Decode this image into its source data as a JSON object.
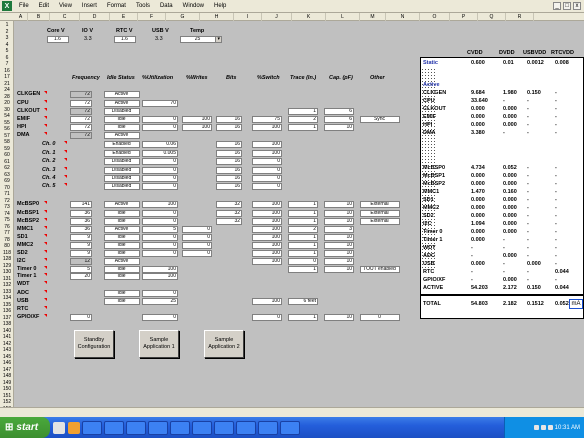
{
  "menubar": {
    "app_icon": "excel-icon",
    "items": [
      "File",
      "Edit",
      "View",
      "Insert",
      "Format",
      "Tools",
      "Data",
      "Window",
      "Help"
    ],
    "window_buttons": [
      "_",
      "□",
      "x"
    ]
  },
  "columns": [
    "A",
    "B",
    "C",
    "D",
    "E",
    "F",
    "G",
    "H",
    "I",
    "J",
    "K",
    "L",
    "M",
    "N",
    "O",
    "P",
    "Q",
    "R"
  ],
  "rows": [
    "1",
    "2",
    "3",
    "4",
    "5",
    "6",
    "7",
    "16",
    "17",
    "21",
    "24",
    "28",
    "20",
    "30",
    "54",
    "55",
    "56",
    "57",
    "58",
    "59",
    "60",
    "61",
    "62",
    "63",
    "69",
    "70",
    "71",
    "72",
    "73",
    "74",
    "75",
    "76",
    "77",
    "78",
    "80",
    "118",
    "128",
    "129",
    "130",
    "131",
    "132",
    "133",
    "134",
    "135",
    "136",
    "137",
    "138",
    "140",
    "141",
    "142",
    "143",
    "145",
    "146",
    "147",
    "148",
    "149",
    "150",
    "151",
    "152",
    "153",
    "154"
  ],
  "settings": {
    "core_v_label": "Core V",
    "core_v_val": "1.6",
    "io_v_label": "IO V",
    "io_v_val": "3.3",
    "rtc_v_label": "RTC V",
    "rtc_v_val": "1.6",
    "usb_v_label": "USB V",
    "usb_v_val": "3.3",
    "temp_label": "Temp",
    "temp_val": "25"
  },
  "table_headers": [
    "Frequency",
    "Idle Status",
    "%Utilization",
    "%Writes",
    "Bits",
    "%Switch",
    "Trace (In.)",
    "Cap. (pF)",
    "Other"
  ],
  "modules": [
    {
      "name": "CLKGEN",
      "freq": "72",
      "status": "Active",
      "util": "",
      "writes": "",
      "bits": "",
      "switch": "",
      "trace": "",
      "cap": "",
      "other": ""
    },
    {
      "name": "CPU",
      "freq": "72",
      "status": "Active",
      "util": "70",
      "writes": "",
      "bits": "",
      "switch": "",
      "trace": "",
      "cap": "",
      "other": ""
    },
    {
      "name": "CLKOUT",
      "freq": "72",
      "status": "Disabled",
      "util": "",
      "writes": "",
      "bits": "",
      "switch": "",
      "trace": "1",
      "cap": "6",
      "other": ""
    },
    {
      "name": "EMIF",
      "freq": "72",
      "status": "Idle",
      "util": "0",
      "writes": "100",
      "bits": "16",
      "switch": "75",
      "trace": "2",
      "cap": "6",
      "other": "Sync"
    },
    {
      "name": "HPI",
      "freq": "72",
      "status": "Idle",
      "util": "0",
      "writes": "100",
      "bits": "16",
      "switch": "100",
      "trace": "1",
      "cap": "10",
      "other": ""
    },
    {
      "name": "DMA",
      "freq": "72",
      "status": "Active",
      "util": "",
      "writes": "",
      "bits": "",
      "switch": "",
      "trace": "",
      "cap": "",
      "other": ""
    },
    {
      "name": "Ch. 0",
      "freq": "",
      "status": "Enabled",
      "util": "0.06",
      "writes": "",
      "bits": "16",
      "switch": "100",
      "trace": "",
      "cap": "",
      "other": ""
    },
    {
      "name": "Ch. 1",
      "freq": "",
      "status": "Enabled",
      "util": "0.005",
      "writes": "",
      "bits": "16",
      "switch": "100",
      "trace": "",
      "cap": "",
      "other": ""
    },
    {
      "name": "Ch. 2",
      "freq": "",
      "status": "Disabled",
      "util": "0",
      "writes": "",
      "bits": "16",
      "switch": "0",
      "trace": "",
      "cap": "",
      "other": ""
    },
    {
      "name": "Ch. 3",
      "freq": "",
      "status": "Disabled",
      "util": "0",
      "writes": "",
      "bits": "16",
      "switch": "0",
      "trace": "",
      "cap": "",
      "other": ""
    },
    {
      "name": "Ch. 4",
      "freq": "",
      "status": "Disabled",
      "util": "0",
      "writes": "",
      "bits": "16",
      "switch": "0",
      "trace": "",
      "cap": "",
      "other": ""
    },
    {
      "name": "Ch. 5",
      "freq": "",
      "status": "Disabled",
      "util": "0",
      "writes": "",
      "bits": "16",
      "switch": "0",
      "trace": "",
      "cap": "",
      "other": ""
    },
    {
      "name": "McBSP0",
      "freq": "141",
      "status": "Active",
      "util": "100",
      "writes": "",
      "bits": "32",
      "switch": "100",
      "trace": "1",
      "cap": "10",
      "other": "External"
    },
    {
      "name": "McBSP1",
      "freq": "36",
      "status": "Idle",
      "util": "0",
      "writes": "",
      "bits": "32",
      "switch": "100",
      "trace": "1",
      "cap": "10",
      "other": "External"
    },
    {
      "name": "McBSP2",
      "freq": "36",
      "status": "Idle",
      "util": "0",
      "writes": "",
      "bits": "32",
      "switch": "100",
      "trace": "1",
      "cap": "10",
      "other": "External"
    },
    {
      "name": "MMC1",
      "freq": "36",
      "status": "Active",
      "util": "5",
      "writes": "0",
      "bits": "",
      "switch": "100",
      "trace": "2",
      "cap": "3",
      "other": ""
    },
    {
      "name": "SD1",
      "freq": "9",
      "status": "Idle",
      "util": "0",
      "writes": "0",
      "bits": "",
      "switch": "100",
      "trace": "1",
      "cap": "10",
      "other": ""
    },
    {
      "name": "MMC2",
      "freq": "9",
      "status": "Idle",
      "util": "0",
      "writes": "0",
      "bits": "",
      "switch": "100",
      "trace": "1",
      "cap": "10",
      "other": ""
    },
    {
      "name": "SD2",
      "freq": "9",
      "status": "Idle",
      "util": "0",
      "writes": "0",
      "bits": "",
      "switch": "100",
      "trace": "1",
      "cap": "10",
      "other": ""
    },
    {
      "name": "I2C",
      "freq": "12",
      "status": "Active",
      "util": "",
      "writes": "",
      "bits": "",
      "switch": "100",
      "trace": "0",
      "cap": "10",
      "other": ""
    },
    {
      "name": "Timer 0",
      "freq": "5",
      "status": "Idle",
      "util": "100",
      "writes": "",
      "bits": "",
      "switch": "",
      "trace": "1",
      "cap": "10",
      "other": "TOUT enabled"
    },
    {
      "name": "Timer 1",
      "freq": "20",
      "status": "Idle",
      "util": "100",
      "writes": "",
      "bits": "",
      "switch": "",
      "trace": "",
      "cap": "",
      "other": ""
    },
    {
      "name": "WDT",
      "freq": "",
      "status": "",
      "util": "",
      "writes": "",
      "bits": "",
      "switch": "",
      "trace": "",
      "cap": "",
      "other": ""
    },
    {
      "name": "ADC",
      "freq": "",
      "status": "Idle",
      "util": "0",
      "writes": "",
      "bits": "",
      "switch": "",
      "trace": "",
      "cap": "",
      "other": ""
    },
    {
      "name": "USB",
      "freq": "",
      "status": "Idle",
      "util": "25",
      "writes": "",
      "bits": "",
      "switch": "100",
      "trace": "6 feet",
      "cap": "",
      "other": ""
    },
    {
      "name": "RTC",
      "freq": "",
      "status": "",
      "util": "",
      "writes": "",
      "bits": "",
      "switch": "",
      "trace": "",
      "cap": "",
      "other": ""
    },
    {
      "name": "GPIO/XF",
      "freq": "0",
      "status": "",
      "util": "0",
      "writes": "",
      "bits": "",
      "switch": "0",
      "trace": "1",
      "cap": "10",
      "other": "0"
    }
  ],
  "panel": {
    "headers": [
      "CVDD",
      "DVDD",
      "USBVDD",
      "RTCVDD"
    ],
    "static_label": "Static",
    "static_vals": [
      "0.600",
      "0.01",
      "0.0012",
      "0.008"
    ],
    "active_label": "Active",
    "rows": [
      {
        "name": "CLKGEN",
        "v": [
          "9.684",
          "1.980",
          "0.150",
          "-"
        ]
      },
      {
        "name": "CPU",
        "v": [
          "33.640",
          "-",
          "-",
          "-"
        ]
      },
      {
        "name": "CLKOUT",
        "v": [
          "0.000",
          "0.000",
          "-",
          "-"
        ]
      },
      {
        "name": "EMIF",
        "v": [
          "0.000",
          "0.000",
          "-",
          "-"
        ]
      },
      {
        "name": "HPI",
        "v": [
          "0.000",
          "0.000",
          "-",
          "-"
        ]
      },
      {
        "name": "DMA",
        "v": [
          "3.380",
          "-",
          "-",
          "-"
        ]
      },
      {
        "name": "McBSP0",
        "v": [
          "4.734",
          "0.052",
          "-",
          "-"
        ]
      },
      {
        "name": "McBSP1",
        "v": [
          "0.000",
          "0.000",
          "-",
          "-"
        ]
      },
      {
        "name": "McBSP2",
        "v": [
          "0.000",
          "0.000",
          "-",
          "-"
        ]
      },
      {
        "name": "MMC1",
        "v": [
          "1.470",
          "0.160",
          "-",
          "-"
        ]
      },
      {
        "name": "SD1",
        "v": [
          "0.000",
          "0.000",
          "-",
          "-"
        ]
      },
      {
        "name": "MMC2",
        "v": [
          "0.000",
          "0.000",
          "-",
          "-"
        ]
      },
      {
        "name": "SD2",
        "v": [
          "0.000",
          "0.000",
          "-",
          "-"
        ]
      },
      {
        "name": "I2C",
        "v": [
          "1.094",
          "0.000",
          "-",
          "-"
        ]
      },
      {
        "name": "Timer 0",
        "v": [
          "0.000",
          "0.000",
          "-",
          "-"
        ]
      },
      {
        "name": "Timer 1",
        "v": [
          "0.000",
          "-",
          "-",
          "-"
        ]
      },
      {
        "name": "WDT",
        "v": [
          "-",
          "-",
          "-",
          "-"
        ]
      },
      {
        "name": "ADC",
        "v": [
          "-",
          "0.000",
          "-",
          "-"
        ]
      },
      {
        "name": "USB",
        "v": [
          "0.000",
          "-",
          "0.000",
          "-"
        ]
      },
      {
        "name": "RTC",
        "v": [
          "-",
          "-",
          "-",
          "0.044"
        ]
      },
      {
        "name": "GPIO/XF",
        "v": [
          "-",
          "0.000",
          "-",
          "-"
        ]
      }
    ],
    "active_total_label": "ACTIVE",
    "active_total": [
      "54.203",
      "2.172",
      "0.150",
      "0.044"
    ],
    "total_label": "TOTAL",
    "total": [
      "54.803",
      "2.182",
      "0.1512",
      "0.052"
    ],
    "unit": "mA"
  },
  "buttons": [
    "Standby Configuration",
    "Sample Application 1",
    "Sample Application 2"
  ],
  "taskbar": {
    "start_label": "start",
    "tasks": [
      "",
      "",
      "",
      "",
      "",
      "",
      "",
      "",
      "",
      ""
    ],
    "clock": "10:31 AM"
  }
}
